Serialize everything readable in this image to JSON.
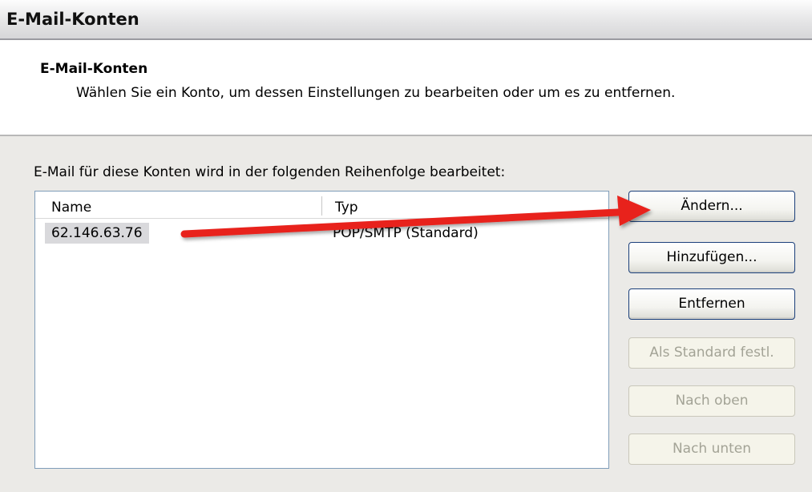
{
  "window": {
    "title": "E-Mail-Konten"
  },
  "header": {
    "heading": "E-Mail-Konten",
    "description": "Wählen Sie ein Konto, um dessen Einstellungen zu bearbeiten oder um es zu entfernen."
  },
  "accounts": {
    "caption": "E-Mail für diese Konten wird in der folgenden Reihenfolge bearbeitet:",
    "columns": [
      "Name",
      "Typ"
    ],
    "rows": [
      {
        "name": "62.146.63.76",
        "type": "POP/SMTP (Standard)"
      }
    ]
  },
  "buttons": {
    "change": "Ändern...",
    "add": "Hinzufügen...",
    "remove": "Entfernen",
    "set_default": "Als Standard festl.",
    "move_up": "Nach oben",
    "move_down": "Nach unten"
  },
  "colors": {
    "annotation_arrow": "#e8231e",
    "selection": "#d9d9dc",
    "panel": "#ebeae7"
  }
}
